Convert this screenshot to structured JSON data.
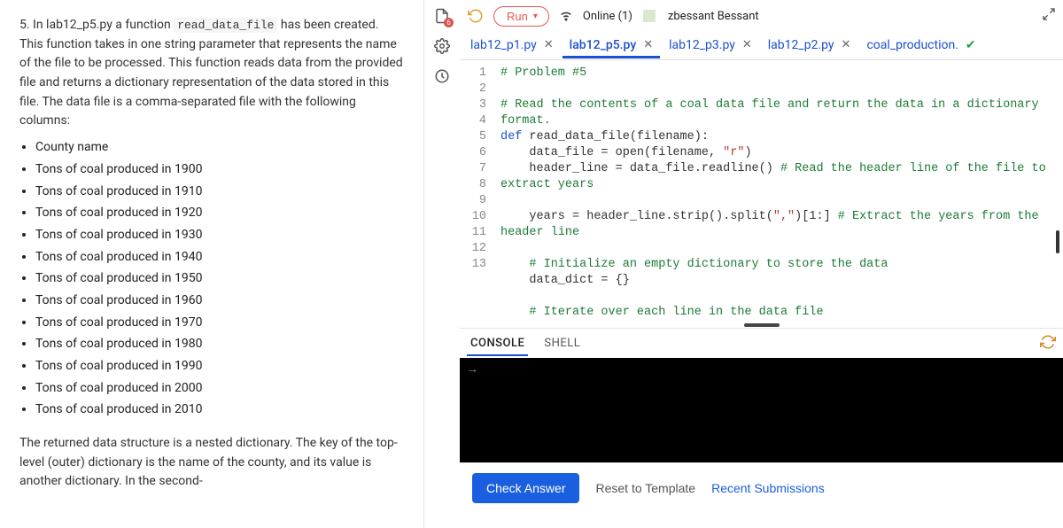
{
  "problem": {
    "number": "5.",
    "intro_before_code": " In lab12_p5.py a function ",
    "fn_name": "read_data_file",
    "intro_after_code": " has been created. This function takes in one string parameter that represents the name of the file to be processed. This function reads data from the provided file and returns a dictionary representation of the data stored in this file. The data file is a comma-separated file with the following columns:",
    "bullets": [
      "County name",
      "Tons of coal produced in 1900",
      "Tons of coal produced in 1910",
      "Tons of coal produced in 1920",
      "Tons of coal produced in 1930",
      "Tons of coal produced in 1940",
      "Tons of coal produced in 1950",
      "Tons of coal produced in 1960",
      "Tons of coal produced in 1970",
      "Tons of coal produced in 1980",
      "Tons of coal produced in 1990",
      "Tons of coal produced in 2000",
      "Tons of coal produced in 2010"
    ],
    "outro": "The returned data structure is a nested dictionary. The key of the top-level (outer) dictionary is the name of the county, and its value is another dictionary. In the second-"
  },
  "side": {
    "badge": "6"
  },
  "topbar": {
    "run": "Run",
    "online": "Online (1)",
    "user": "zbessant Bessant"
  },
  "tabs": [
    {
      "label": "lab12_p1.py",
      "active": false
    },
    {
      "label": "lab12_p5.py",
      "active": true
    },
    {
      "label": "lab12_p3.py",
      "active": false
    },
    {
      "label": "lab12_p2.py",
      "active": false
    },
    {
      "label": "coal_production.",
      "active": false,
      "check": true
    }
  ],
  "code": {
    "lines": [
      {
        "n": 1,
        "html": "<span class='c-comment'># Problem #5</span>"
      },
      {
        "n": 2,
        "html": ""
      },
      {
        "n": 3,
        "html": "<span class='c-comment'># Read the contents of a coal data file and return the data in a dictionary format.</span>"
      },
      {
        "n": 4,
        "html": "<span class='c-kw'>def</span> <span class='c-fn'>read_data_file</span>(filename):"
      },
      {
        "n": 5,
        "html": "    data_file = open(filename, <span class='c-str'>\"r\"</span>)"
      },
      {
        "n": 6,
        "html": "    header_line = data_file.readline() <span class='c-comment'># Read the header line of the file to extract years</span>"
      },
      {
        "n": 7,
        "html": ""
      },
      {
        "n": 8,
        "html": "    years = header_line.strip().split(<span class='c-str'>\",\"</span>)[1:] <span class='c-comment'># Extract the years from the header line</span>"
      },
      {
        "n": 9,
        "html": ""
      },
      {
        "n": 10,
        "html": "    <span class='c-comment'># Initialize an empty dictionary to store the data</span>"
      },
      {
        "n": 11,
        "html": "    data_dict = {}"
      },
      {
        "n": 12,
        "html": ""
      },
      {
        "n": 13,
        "html": "    <span class='c-comment'># Iterate over each line in the data file</span>"
      }
    ]
  },
  "console": {
    "tabs": [
      "CONSOLE",
      "SHELL"
    ],
    "prompt": "→"
  },
  "bottom": {
    "check": "Check Answer",
    "reset": "Reset to Template",
    "recent": "Recent Submissions"
  }
}
